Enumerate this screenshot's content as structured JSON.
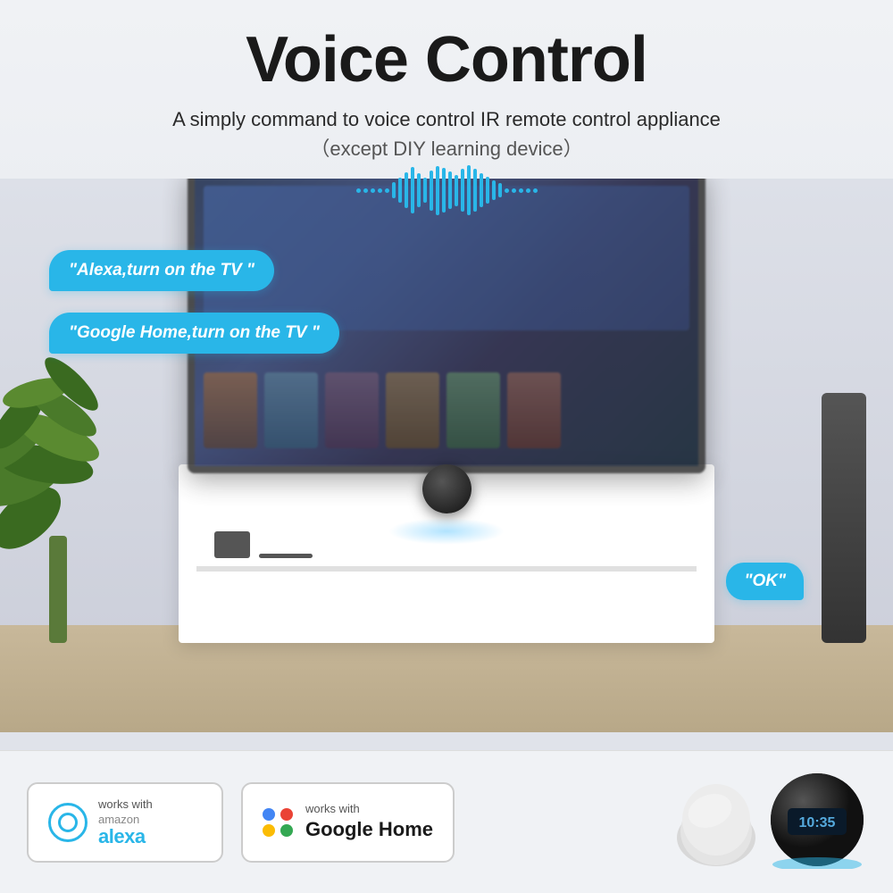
{
  "header": {
    "title": "Voice Control",
    "subtitle_main": "A simply command to voice control IR remote control appliance",
    "subtitle_paren": "（except DIY learning device）"
  },
  "bubbles": {
    "alexa": "\"Alexa,turn on the TV \"",
    "google": "\"Google Home,turn on the TV \"",
    "ok": "\"OK\""
  },
  "badges": {
    "alexa": {
      "works_with": "works with",
      "brand": "amazon alexa"
    },
    "google": {
      "works_with": "works with",
      "brand": "Google Home"
    }
  },
  "echo_screen": "10:35",
  "colors": {
    "cyan": "#29b6e8",
    "dark": "#1a1a1a",
    "bg": "#e8eaed"
  }
}
